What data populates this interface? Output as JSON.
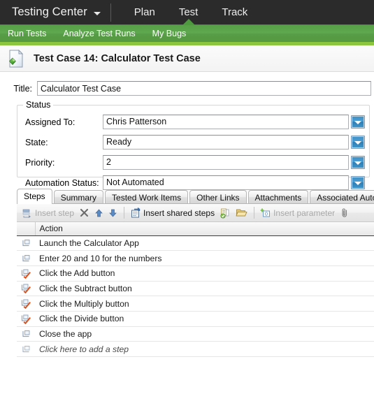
{
  "topnav": {
    "brand": "Testing Center",
    "brand_caret_icon": "chevron-down-icon",
    "items": [
      {
        "label": "Plan",
        "active": false
      },
      {
        "label": "Test",
        "active": true
      },
      {
        "label": "Track",
        "active": false
      }
    ]
  },
  "subnav": {
    "items": [
      {
        "label": "Run Tests"
      },
      {
        "label": "Analyze Test Runs"
      },
      {
        "label": "My Bugs"
      }
    ],
    "accent_color": "#5fa84f",
    "underline_color": "#8cc63e"
  },
  "page": {
    "icon": "test-case-document-icon",
    "title": "Test Case 14: Calculator Test Case"
  },
  "form": {
    "title_label": "Title:",
    "title_value": "Calculator Test Case",
    "status_group_label": "Status",
    "fields": [
      {
        "label": "Assigned To:",
        "value": "Chris Patterson",
        "dropdown_icon": "dropdown-arrow-icon"
      },
      {
        "label": "State:",
        "value": "Ready",
        "dropdown_icon": "dropdown-arrow-icon"
      },
      {
        "label": "Priority:",
        "value": "2",
        "dropdown_icon": "dropdown-arrow-icon"
      },
      {
        "label": "Automation Status:",
        "value": "Not Automated",
        "dropdown_icon": "dropdown-arrow-icon"
      }
    ]
  },
  "tabs": [
    {
      "label": "Steps",
      "active": true
    },
    {
      "label": "Summary",
      "active": false
    },
    {
      "label": "Tested Work Items",
      "active": false
    },
    {
      "label": "Other Links",
      "active": false
    },
    {
      "label": "Attachments",
      "active": false
    },
    {
      "label": "Associated Autom",
      "active": false
    }
  ],
  "toolbar": {
    "insert_step_label": "Insert step",
    "insert_step_icon": "insert-step-icon",
    "delete_icon": "delete-x-icon",
    "move_up_icon": "arrow-up-icon",
    "move_down_icon": "arrow-down-icon",
    "insert_shared_steps_label": "Insert shared steps",
    "insert_shared_steps_icon": "insert-shared-steps-icon",
    "create_shared_steps_icon": "create-shared-steps-icon",
    "open_shared_steps_icon": "open-folder-icon",
    "insert_parameter_label": "Insert parameter",
    "insert_parameter_icon": "insert-parameter-icon",
    "attachment_icon": "paperclip-icon"
  },
  "grid": {
    "columns": [
      {
        "key": "icon",
        "label": ""
      },
      {
        "key": "action",
        "label": "Action"
      }
    ],
    "rows": [
      {
        "icon": "step-icon",
        "action": "Launch the Calculator App",
        "validation": false,
        "placeholder": false
      },
      {
        "icon": "step-icon",
        "action": "Enter 20 and 10 for the numbers",
        "validation": false,
        "placeholder": false
      },
      {
        "icon": "step-validation-icon",
        "action": "Click the Add button",
        "validation": true,
        "placeholder": false
      },
      {
        "icon": "step-validation-icon",
        "action": "Click the Subtract button",
        "validation": true,
        "placeholder": false
      },
      {
        "icon": "step-validation-icon",
        "action": "Click the Multiply button",
        "validation": true,
        "placeholder": false
      },
      {
        "icon": "step-validation-icon",
        "action": "Click the Divide button",
        "validation": true,
        "placeholder": false
      },
      {
        "icon": "step-icon",
        "action": "Close the app",
        "validation": false,
        "placeholder": false
      },
      {
        "icon": "step-icon",
        "action": "Click here to add a step",
        "validation": false,
        "placeholder": true
      }
    ]
  }
}
